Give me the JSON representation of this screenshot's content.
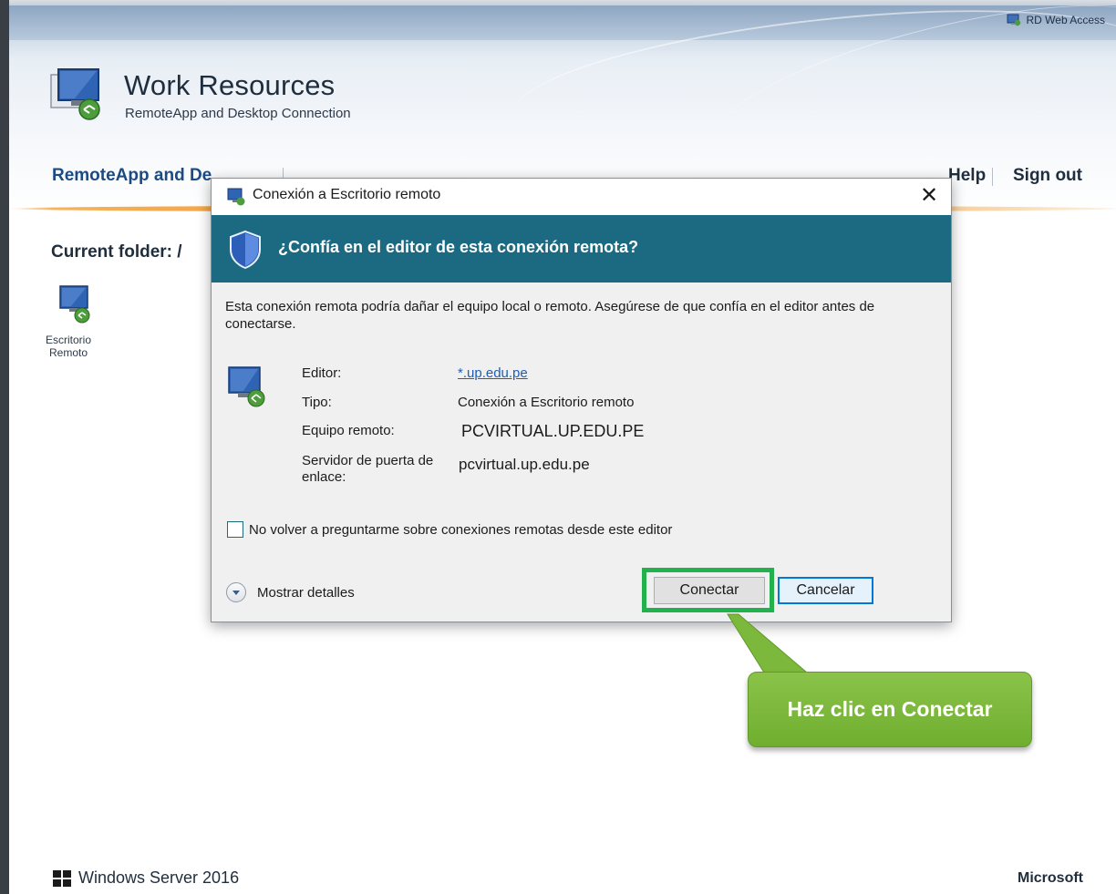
{
  "header": {
    "rd_web_access": "RD Web Access",
    "app_title": "Work Resources",
    "app_subtitle": "RemoteApp and Desktop Connection"
  },
  "nav": {
    "left_label": "RemoteApp and De",
    "help_label": "Help",
    "signout_label": "Sign out"
  },
  "content": {
    "current_folder": "Current folder: /",
    "resource_label": "Escritorio Remoto"
  },
  "dialog": {
    "title": "Conexión a Escritorio remoto",
    "close_symbol": "✕",
    "banner_question": "¿Confía en el editor de esta conexión remota?",
    "message": "Esta conexión remota podría dañar el equipo local o remoto. Asegúrese de que confía en el editor antes de conectarse.",
    "fields": {
      "editor_label": "Editor:",
      "editor_value": "*.up.edu.pe",
      "tipo_label": "Tipo:",
      "tipo_value": "Conexión a Escritorio remoto",
      "equipo_label": "Equipo remoto:",
      "equipo_value": "PCVIRTUAL.UP.EDU.PE",
      "servidor_label": "Servidor de puerta de enlace:",
      "servidor_value": "pcvirtual.up.edu.pe"
    },
    "checkbox_label": "No volver a preguntarme sobre conexiones remotas desde este editor",
    "checkbox_checked": false,
    "details_label": "Mostrar detalles",
    "connect_label": "Conectar",
    "cancel_label": "Cancelar",
    "banner_color": "#1b6a82"
  },
  "annotation": {
    "callout_text": "Haz clic en Conectar",
    "highlight_color": "#22b14c",
    "callout_color": "#7cb83c"
  },
  "footer": {
    "os_label": "Windows Server 2016",
    "brand": "Microsoft"
  },
  "icons": [
    "rd-web-access-icon",
    "remote-desktop-icon",
    "shield-icon",
    "close-icon",
    "windows-logo-icon",
    "chevron-down-icon"
  ]
}
